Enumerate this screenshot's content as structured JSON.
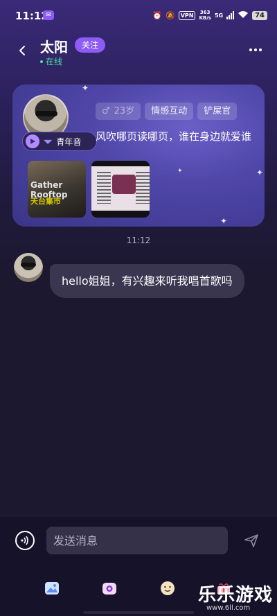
{
  "status_bar": {
    "time": "11:12",
    "vpn": "VPN",
    "net_speed_value": "363",
    "net_speed_unit": "KB/s",
    "network": "5G",
    "battery": "74"
  },
  "header": {
    "name": "太阳",
    "follow_label": "关注",
    "status": "在线"
  },
  "profile_card": {
    "voice_label": "青年音",
    "tags": [
      "23岁",
      "情感互动",
      "铲屎官"
    ],
    "signature": "风吹哪页读哪页，谁在身边就爱谁",
    "photo1_text_a": "Gather Rooftop",
    "photo1_text_b": "天台集市"
  },
  "chat": {
    "timestamp": "11:12",
    "messages": [
      {
        "from": "other",
        "text": "hello姐姐，有兴趣来听我唱首歌吗"
      }
    ]
  },
  "input_bar": {
    "placeholder": "发送消息"
  },
  "watermark": {
    "text": "乐乐游戏",
    "url": "www.6ll.com"
  },
  "colors": {
    "accent": "#8d5cf6",
    "online": "#4ce3a0",
    "bubble": "#3a3650"
  }
}
